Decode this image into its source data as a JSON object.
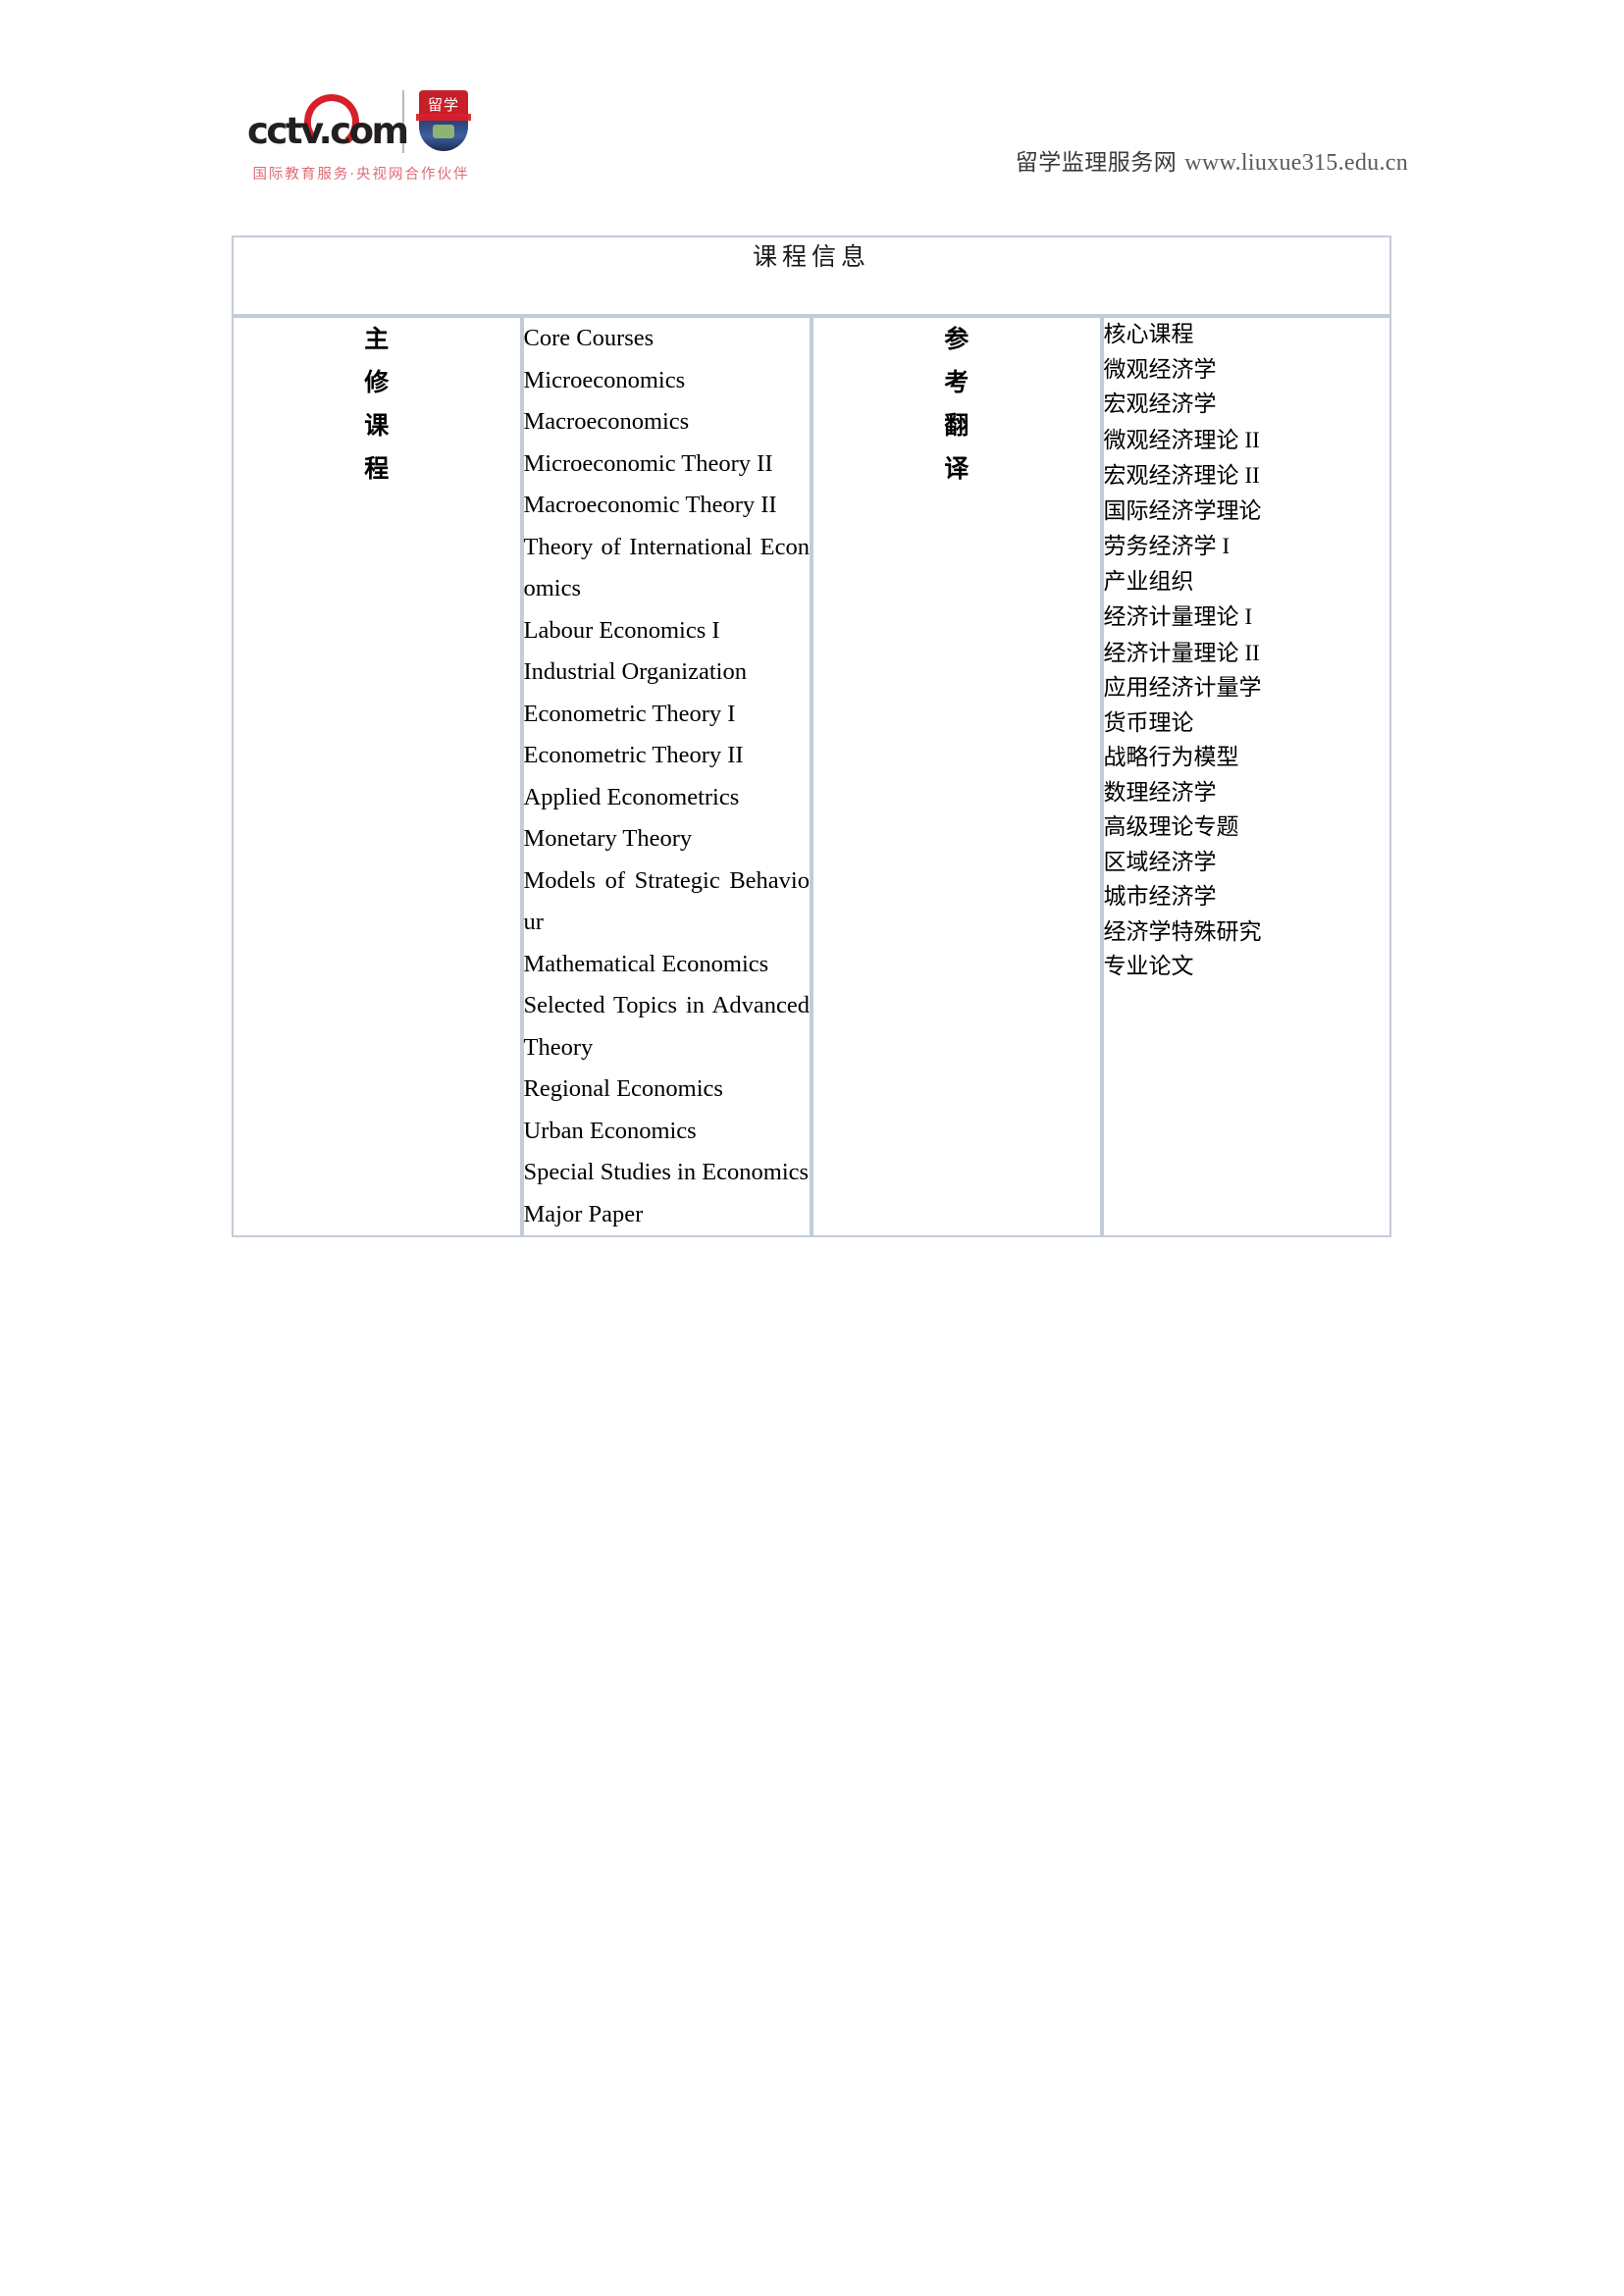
{
  "header": {
    "logo": {
      "wordmark": "cctv.com",
      "badge_label": "留学",
      "tagline": "国际教育服务·央视网合作伙伴"
    },
    "site_name": "留学监理服务网",
    "site_url": "www.liuxue315.edu.cn"
  },
  "table": {
    "title": "课程信息",
    "rows": [
      {
        "label_en_col": "主修课程",
        "label_cn_col": "参考翻译",
        "english_lines": [
          {
            "text": "Core Courses",
            "justify": false
          },
          {
            "text": "Microeconomics",
            "justify": false
          },
          {
            "text": "Macroeconomics",
            "justify": false
          },
          {
            "text": "Microeconomic Theory II",
            "justify": false
          },
          {
            "text": "Macroeconomic Theory II",
            "justify": false
          },
          {
            "text": "Theory of International Economics",
            "justify": true
          },
          {
            "text": "Labour Economics I",
            "justify": false
          },
          {
            "text": "Industrial Organization",
            "justify": false
          },
          {
            "text": "Econometric Theory I",
            "justify": false
          },
          {
            "text": "Econometric Theory II",
            "justify": false
          },
          {
            "text": "Applied Econometrics",
            "justify": false
          },
          {
            "text": "Monetary Theory",
            "justify": false
          },
          {
            "text": "Models of Strategic Behaviour",
            "justify": true
          },
          {
            "text": "Mathematical Economics",
            "justify": false
          },
          {
            "text": "Selected Topics in Advanced Theory",
            "justify": true
          },
          {
            "text": "Regional Economics",
            "justify": false
          },
          {
            "text": "Urban Economics",
            "justify": false
          },
          {
            "text": "Special Studies in Economics",
            "justify": false
          },
          {
            "text": "Major Paper",
            "justify": false
          }
        ],
        "chinese_lines": [
          {
            "text": "核心课程",
            "numeral": ""
          },
          {
            "text": "微观经济学",
            "numeral": ""
          },
          {
            "text": "宏观经济学",
            "numeral": ""
          },
          {
            "text": "微观经济理论",
            "numeral": "II"
          },
          {
            "text": "宏观经济理论",
            "numeral": "II"
          },
          {
            "text": "国际经济学理论",
            "numeral": ""
          },
          {
            "text": "劳务经济学",
            "numeral": "I"
          },
          {
            "text": "产业组织",
            "numeral": ""
          },
          {
            "text": "经济计量理论",
            "numeral": "I"
          },
          {
            "text": "经济计量理论",
            "numeral": "II"
          },
          {
            "text": "应用经济计量学",
            "numeral": ""
          },
          {
            "text": "货币理论",
            "numeral": ""
          },
          {
            "text": "战略行为模型",
            "numeral": ""
          },
          {
            "text": "数理经济学",
            "numeral": ""
          },
          {
            "text": "高级理论专题",
            "numeral": ""
          },
          {
            "text": "区域经济学",
            "numeral": ""
          },
          {
            "text": "城市经济学",
            "numeral": ""
          },
          {
            "text": "经济学特殊研究",
            "numeral": ""
          },
          {
            "text": "专业论文",
            "numeral": ""
          }
        ]
      }
    ]
  },
  "colors": {
    "title_background": "#e2eff9",
    "table_border": "#c3ccd8",
    "logo_red": "#d8202a",
    "tagline_red": "#e06a74",
    "page_background": "#ffffff"
  }
}
